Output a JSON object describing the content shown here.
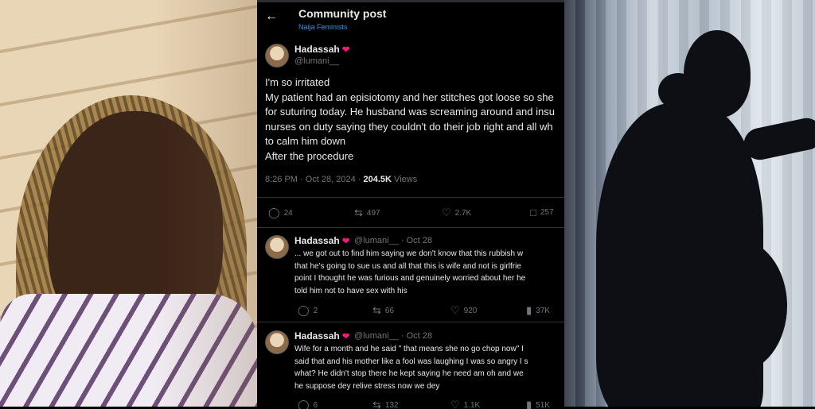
{
  "header": {
    "back_icon": "back-arrow-icon",
    "title": "Community post",
    "community": "Naija Feminists"
  },
  "post": {
    "author": "Hadassah",
    "badge_icon": "lips-icon",
    "handle": "@lumani__",
    "lines": [
      "I'm so irritated",
      "My patient had an episiotomy and her stitches got loose so she",
      "for suturing today. He husband was screaming around and insu",
      "nurses on duty saying they couldn't do their job right and all wh",
      "to calm him down",
      "After the procedure"
    ],
    "time": "8:26 PM · Oct 28, 2024 · ",
    "views_count": "204.5K",
    "views_label": " Views",
    "actions": {
      "replies": "24",
      "reposts": "497",
      "likes": "2.7K",
      "bookmarks": "257"
    }
  },
  "replies": [
    {
      "author": "Hadassah",
      "handle": "@lumani__ · Oct 28",
      "lines": [
        "... we got out to find him saying we don't know that this rubbish w",
        "that he's going to sue us and all that this is wife and not is girlfrie",
        "point I thought he was furious and genuinely worried about her he",
        "told him not to have sex with his"
      ],
      "actions": {
        "replies": "2",
        "reposts": "66",
        "likes": "920",
        "views": "37K"
      }
    },
    {
      "author": "Hadassah",
      "handle": "@lumani__ · Oct 28",
      "lines": [
        "Wife for a month and he said \" that means she no go chop now\" I",
        "said that and his mother like a fool was laughing I was so angry I s",
        "what? He didn't stop there he kept saying he need am oh and we",
        "he suppose dey relive stress now we dey"
      ],
      "actions": {
        "replies": "6",
        "reposts": "132",
        "likes": "1.1K",
        "views": "51K"
      }
    }
  ]
}
